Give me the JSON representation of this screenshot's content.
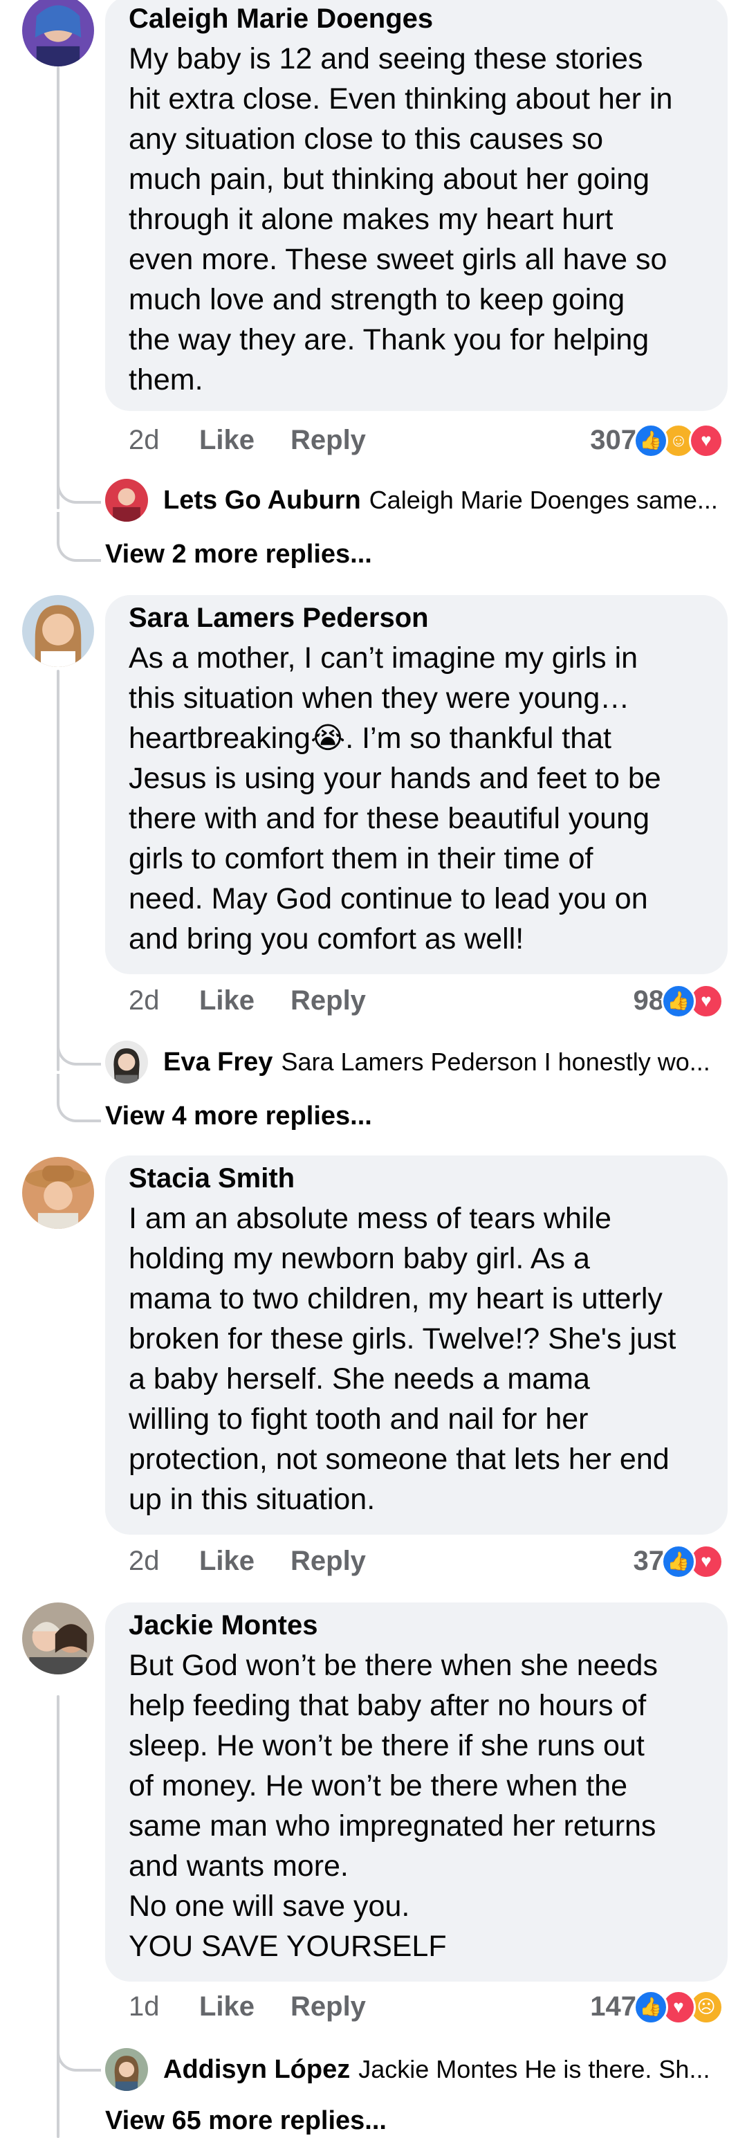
{
  "comments": [
    {
      "author": "Caleigh Marie Doenges",
      "body": "My baby is 12 and seeing these stories\nhit extra close. Even thinking about her in\nany situation close to this causes so\nmuch pain, but thinking about her going\nthrough it alone makes my heart hurt\neven more. These sweet girls all have so\nmuch love and strength to keep going\nthe way they are. Thank you for helping\nthem.",
      "time": "2d",
      "like_label": "Like",
      "reply_label": "Reply",
      "reaction_count": "307",
      "reactions": [
        "like-icon",
        "care-icon",
        "love-icon"
      ],
      "reply": {
        "author": "Lets Go Auburn",
        "text": "Caleigh Marie Doenges same..."
      },
      "view_more": "View 2 more replies..."
    },
    {
      "author": "Sara Lamers Pederson",
      "body": "As a mother, I can’t imagine my girls in\nthis situation when they were young…\nheartbreaking😭.  I’m so thankful that\nJesus is using your hands and feet to be\nthere with and for these beautiful young\ngirls to comfort them in their time of\nneed. May God continue to lead you on\nand bring you comfort as well!",
      "time": "2d",
      "like_label": "Like",
      "reply_label": "Reply",
      "reaction_count": "98",
      "reactions": [
        "like-icon",
        "love-icon"
      ],
      "reply": {
        "author": "Eva Frey",
        "text": "Sara Lamers Pederson I honestly wo..."
      },
      "view_more": "View 4 more replies..."
    },
    {
      "author": "Stacia Smith",
      "body": "I am an absolute mess of tears while\nholding my newborn baby girl. As a\nmama to two children, my heart is utterly\nbroken for these girls. Twelve!? She's just\na baby herself. She needs a mama\nwilling to fight tooth and nail for her\nprotection, not someone that lets her end\nup in this situation.",
      "time": "2d",
      "like_label": "Like",
      "reply_label": "Reply",
      "reaction_count": "37",
      "reactions": [
        "like-icon",
        "love-icon"
      ]
    },
    {
      "author": "Jackie Montes",
      "body": "But God won’t be there when she needs\nhelp feeding that baby after no hours of\nsleep. He won’t be there if she runs out\nof money. He won’t be there when the\nsame man who impregnated her returns\nand wants more.\nNo one will save you.\nYOU SAVE YOURSELF",
      "time": "1d",
      "like_label": "Like",
      "reply_label": "Reply",
      "reaction_count": "147",
      "reactions": [
        "like-icon",
        "love-icon",
        "sad-icon"
      ],
      "reply": {
        "author": "Addisyn López",
        "text": "Jackie Montes He is there. Sh..."
      },
      "view_more": "View 65 more replies..."
    }
  ],
  "colors": {
    "bubble": "#f0f2f5",
    "meta": "#65676b",
    "like": "#1877f2",
    "love": "#f33e58",
    "care": "#f7b125"
  }
}
